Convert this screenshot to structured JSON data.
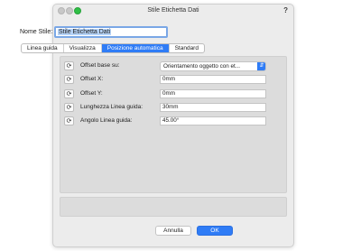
{
  "window": {
    "title": "Stile Etichetta Dati",
    "help": "?"
  },
  "name": {
    "label": "Nome Stile:",
    "value": "Stile Etichetta Dati"
  },
  "tabs": [
    {
      "label": "Linea guida",
      "active": false
    },
    {
      "label": "Visualizza",
      "active": false
    },
    {
      "label": "Posizione automatica",
      "active": true
    },
    {
      "label": "Standard",
      "active": false
    }
  ],
  "rows": [
    {
      "label": "Offset base su:",
      "value": "Orientamento oggetto con et..."
    },
    {
      "label": "Offset X:",
      "value": "0mm"
    },
    {
      "label": "Offset Y:",
      "value": "0mm"
    },
    {
      "label": "Lunghezza Linea guida:",
      "value": "30mm"
    },
    {
      "label": "Angolo Linea guida:",
      "value": "45.00°"
    }
  ],
  "buttons": {
    "cancel": "Annulla",
    "ok": "OK"
  },
  "colors": {
    "accent": "#2f7cf6",
    "panel": "#dcdcdc",
    "window": "#ececec"
  },
  "icons": {
    "row_icon": "style-toggle-icon",
    "select_arrow": "updown-chevron-icon"
  }
}
